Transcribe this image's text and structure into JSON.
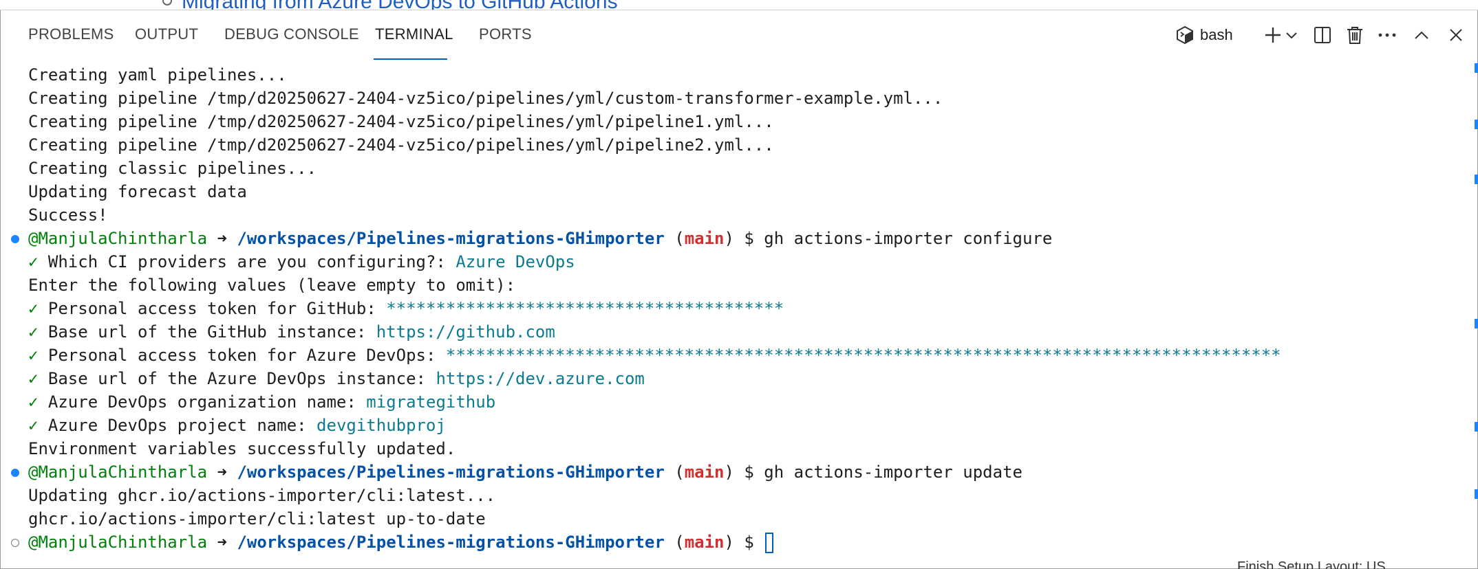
{
  "background_doc": {
    "fragment_text": "Migrating from Azure DevOps to GitHub Actions"
  },
  "panel": {
    "tabs": [
      {
        "label": "PROBLEMS"
      },
      {
        "label": "OUTPUT"
      },
      {
        "label": "DEBUG CONSOLE"
      },
      {
        "label": "TERMINAL",
        "active": true
      },
      {
        "label": "PORTS"
      }
    ],
    "toolbar": {
      "shell_label": "bash",
      "icons": [
        "terminal-icon",
        "add-icon",
        "chevron-down-icon",
        "split-icon",
        "trash-icon",
        "more-icon",
        "chevron-up-icon",
        "close-icon"
      ]
    }
  },
  "terminal": {
    "lines": [
      {
        "text": "Creating yaml pipelines..."
      },
      {
        "text": "Creating pipeline /tmp/d20250627-2404-vz5ico/pipelines/yml/custom-transformer-example.yml..."
      },
      {
        "text": "Creating pipeline /tmp/d20250627-2404-vz5ico/pipelines/yml/pipeline1.yml..."
      },
      {
        "text": "Creating pipeline /tmp/d20250627-2404-vz5ico/pipelines/yml/pipeline2.yml..."
      },
      {
        "text": "Creating classic pipelines..."
      },
      {
        "text": "Updating forecast data"
      },
      {
        "text": "Success!"
      }
    ],
    "prompt1": {
      "user": "@ManjulaChintharla",
      "arrow": "➜",
      "path": "/workspaces/Pipelines-migrations-GHimporter",
      "branch_open": "(",
      "branch": "main",
      "branch_close": ")",
      "dollar": "$",
      "command": "gh actions-importer configure"
    },
    "configure": {
      "check": "✓",
      "q1_label": "Which CI providers are you configuring?:",
      "q1_value": "Azure DevOps",
      "enter_line": "Enter the following values (leave empty to omit):",
      "q2_label": "Personal access token for GitHub:",
      "q2_value": "****************************************",
      "q3_label": "Base url of the GitHub instance:",
      "q3_value": "https://github.com",
      "q4_label": "Personal access token for Azure DevOps:",
      "q4_value": "************************************************************************************",
      "q5_label": "Base url of the Azure DevOps instance:",
      "q5_value": "https://dev.azure.com",
      "q6_label": "Azure DevOps organization name:",
      "q6_value": "migrategithub",
      "q7_label": "Azure DevOps project name:",
      "q7_value": "devgithubproj",
      "done": "Environment variables successfully updated."
    },
    "prompt2": {
      "command": "gh actions-importer update"
    },
    "update_lines": [
      {
        "text": "Updating ghcr.io/actions-importer/cli:latest..."
      },
      {
        "text": "ghcr.io/actions-importer/cli:latest up-to-date"
      }
    ],
    "prompt3": {
      "command": ""
    }
  },
  "status_fragment": "Finish Setup    Layout: US"
}
